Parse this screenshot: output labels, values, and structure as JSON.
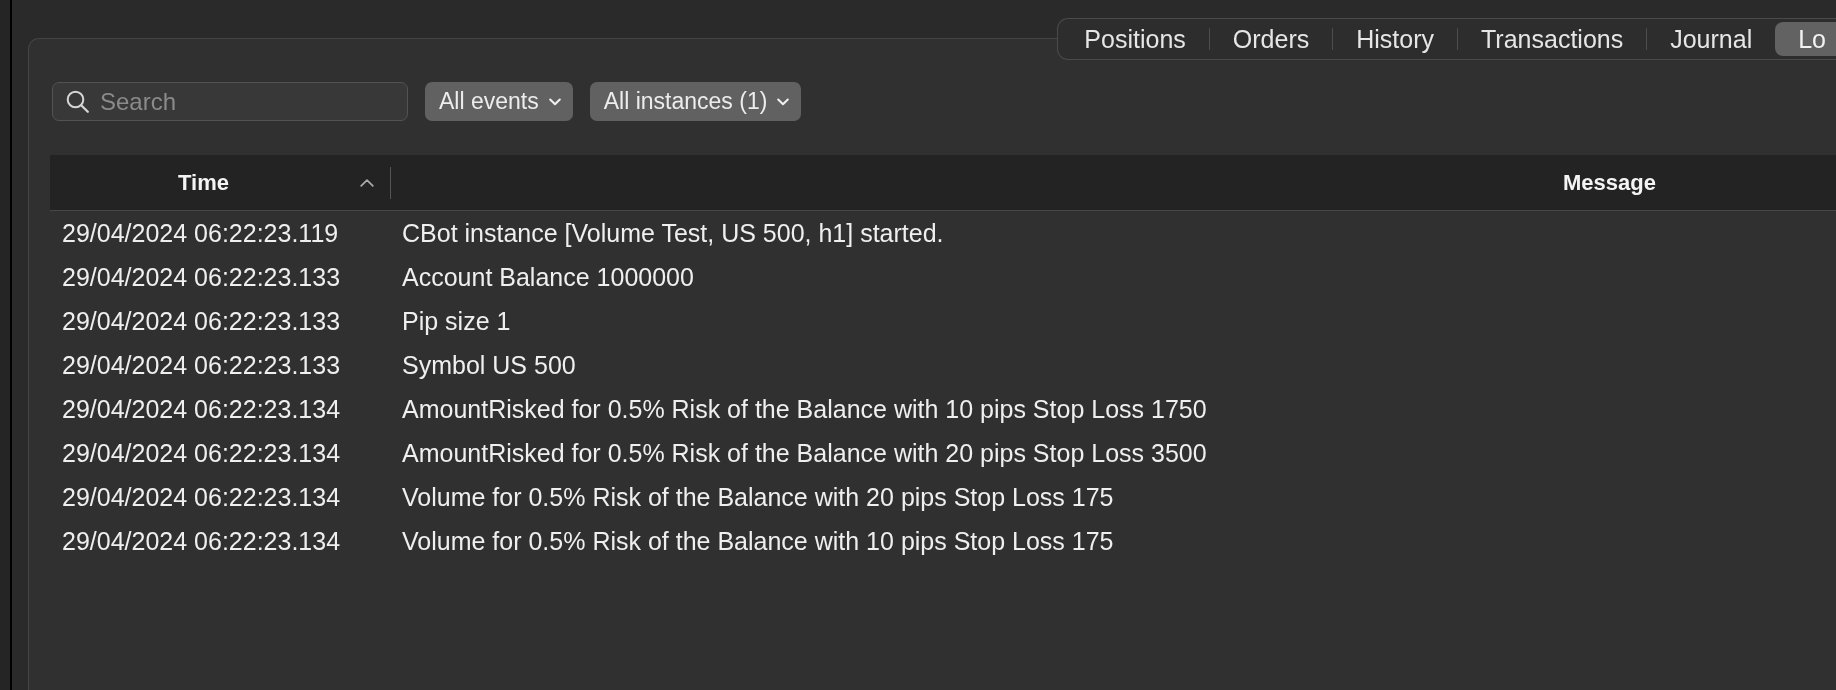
{
  "tabs": [
    {
      "label": "Positions",
      "selected": false
    },
    {
      "label": "Orders",
      "selected": false
    },
    {
      "label": "History",
      "selected": false
    },
    {
      "label": "Transactions",
      "selected": false
    },
    {
      "label": "Journal",
      "selected": false
    },
    {
      "label": "Lo",
      "selected": true
    }
  ],
  "toolbar": {
    "search": {
      "placeholder": "Search"
    },
    "filters": [
      {
        "label": "All events"
      },
      {
        "label": "All instances (1)"
      }
    ]
  },
  "table": {
    "columns": [
      {
        "label": "Time",
        "sorted": true
      },
      {
        "label": "Message",
        "sorted": false
      }
    ],
    "rows": [
      {
        "time": "29/04/2024 06:22:23.119",
        "message": "CBot instance [Volume Test, US 500, h1] started."
      },
      {
        "time": "29/04/2024 06:22:23.133",
        "message": "Account Balance 1000000"
      },
      {
        "time": "29/04/2024 06:22:23.133",
        "message": "Pip size 1"
      },
      {
        "time": "29/04/2024 06:22:23.133",
        "message": "Symbol US 500"
      },
      {
        "time": "29/04/2024 06:22:23.134",
        "message": "AmountRisked for 0.5% Risk of the Balance with 10 pips Stop Loss 1750"
      },
      {
        "time": "29/04/2024 06:22:23.134",
        "message": "AmountRisked for 0.5% Risk of the Balance with 20 pips Stop Loss 3500"
      },
      {
        "time": "29/04/2024 06:22:23.134",
        "message": "Volume for 0.5% Risk of the Balance with 20 pips Stop Loss 175"
      },
      {
        "time": "29/04/2024 06:22:23.134",
        "message": "Volume for 0.5% Risk of the Balance with 10 pips Stop Loss 175"
      }
    ]
  }
}
